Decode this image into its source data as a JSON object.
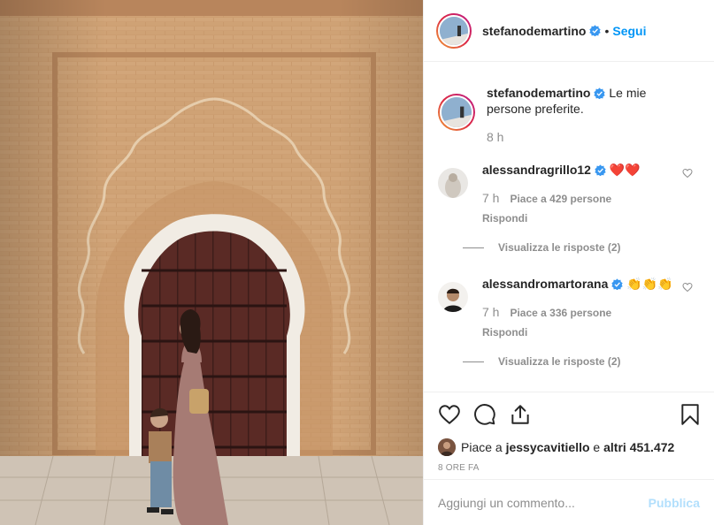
{
  "post": {
    "image_alt": "Post photo",
    "author": {
      "username": "stefanodemartino",
      "verified": true,
      "follow_label": "Segui",
      "separator": "•"
    },
    "caption": {
      "username": "stefanodemartino",
      "text": "Le mie persone preferite.",
      "time": "8 h"
    },
    "comments": [
      {
        "username": "alessandragrillo12",
        "verified": true,
        "text": "❤️❤️",
        "time": "7 h",
        "likes": "Piace a 429 persone",
        "reply_label": "Rispondi",
        "view_replies": "Visualizza le risposte (2)"
      },
      {
        "username": "alessandromartorana",
        "verified": true,
        "text": "👏👏👏",
        "time": "7 h",
        "likes": "Piace a 336 persone",
        "reply_label": "Rispondi",
        "view_replies": "Visualizza le risposte (2)"
      }
    ],
    "likes_summary": {
      "prefix": "Piace a ",
      "user": "jessycavitiello",
      "middle": " e ",
      "others": "altri 451.472"
    },
    "ago": "8 ore fa",
    "add_comment": {
      "placeholder": "Aggiungi un commento...",
      "publish_label": "Pubblica"
    }
  },
  "icons": {
    "like": "heart-icon",
    "comment": "comment-icon",
    "share": "share-icon",
    "save": "bookmark-icon",
    "verified": "verified-badge-icon"
  },
  "colors": {
    "link": "#0095f6",
    "verified": "#3897f0",
    "muted": "#8e8e8e",
    "publish_disabled": "#b2dffc"
  }
}
